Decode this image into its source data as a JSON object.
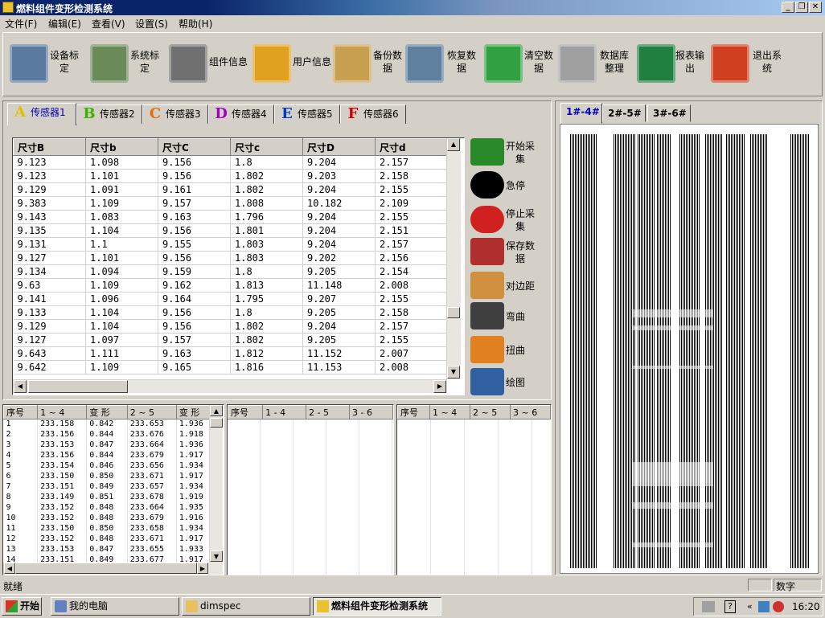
{
  "window": {
    "title": "燃料组件变形检测系统"
  },
  "menu": [
    "文件(F)",
    "编辑(E)",
    "查看(V)",
    "设置(S)",
    "帮助(H)"
  ],
  "toolbar": [
    {
      "label": "设备标\n定",
      "icon": "device-calibration-icon",
      "color": "#5a7aa0"
    },
    {
      "label": "系统标\n定",
      "icon": "system-calibration-icon",
      "color": "#6a8a5a"
    },
    {
      "label": "组件信息",
      "icon": "gears-icon",
      "color": "#707070"
    },
    {
      "label": "用户信息",
      "icon": "users-icon",
      "color": "#e0a020"
    },
    {
      "label": "备份数\n据",
      "icon": "backup-icon",
      "color": "#c8a050"
    },
    {
      "label": "恢复数\n据",
      "icon": "restore-icon",
      "color": "#6080a0"
    },
    {
      "label": "清空数\n据",
      "icon": "recycle-bin-icon",
      "color": "#30a040"
    },
    {
      "label": "数据库\n整理",
      "icon": "wrench-icon",
      "color": "#a0a0a0"
    },
    {
      "label": "报表输\n出",
      "icon": "excel-icon",
      "color": "#208040"
    },
    {
      "label": "退出系\n统",
      "icon": "windows-logo-icon",
      "color": "#d04020"
    }
  ],
  "sensor_tabs": [
    {
      "letter": "A",
      "label": "传感器1",
      "color": "#e0c000"
    },
    {
      "letter": "B",
      "label": "传感器2",
      "color": "#40b000"
    },
    {
      "letter": "C",
      "label": "传感器3",
      "color": "#e07000"
    },
    {
      "letter": "D",
      "label": "传感器4",
      "color": "#a000c0"
    },
    {
      "letter": "E",
      "label": "传感器5",
      "color": "#0040c0"
    },
    {
      "letter": "F",
      "label": "传感器6",
      "color": "#d00000"
    }
  ],
  "main_grid": {
    "headers": [
      "尺寸B",
      "尺寸b",
      "尺寸C",
      "尺寸c",
      "尺寸D",
      "尺寸d"
    ],
    "rows": [
      [
        "9.123",
        "1.098",
        "9.156",
        "1.8",
        "9.204",
        "2.157"
      ],
      [
        "9.123",
        "1.101",
        "9.156",
        "1.802",
        "9.203",
        "2.158"
      ],
      [
        "9.129",
        "1.091",
        "9.161",
        "1.802",
        "9.204",
        "2.155"
      ],
      [
        "9.383",
        "1.109",
        "9.157",
        "1.808",
        "10.182",
        "2.109"
      ],
      [
        "9.143",
        "1.083",
        "9.163",
        "1.796",
        "9.204",
        "2.155"
      ],
      [
        "9.135",
        "1.104",
        "9.156",
        "1.801",
        "9.204",
        "2.151"
      ],
      [
        "9.131",
        "1.1",
        "9.155",
        "1.803",
        "9.204",
        "2.157"
      ],
      [
        "9.127",
        "1.101",
        "9.156",
        "1.803",
        "9.202",
        "2.156"
      ],
      [
        "9.134",
        "1.094",
        "9.159",
        "1.8",
        "9.205",
        "2.154"
      ],
      [
        "9.63",
        "1.109",
        "9.162",
        "1.813",
        "11.148",
        "2.008"
      ],
      [
        "9.141",
        "1.096",
        "9.164",
        "1.795",
        "9.207",
        "2.155"
      ],
      [
        "9.133",
        "1.104",
        "9.156",
        "1.8",
        "9.205",
        "2.158"
      ],
      [
        "9.129",
        "1.104",
        "9.156",
        "1.802",
        "9.204",
        "2.157"
      ],
      [
        "9.127",
        "1.097",
        "9.157",
        "1.802",
        "9.205",
        "2.155"
      ],
      [
        "9.643",
        "1.111",
        "9.163",
        "1.812",
        "11.152",
        "2.007"
      ],
      [
        "9.642",
        "1.109",
        "9.165",
        "1.816",
        "11.153",
        "2.008"
      ]
    ]
  },
  "side_buttons": [
    {
      "label": "开始采\n集",
      "icon": "start-collect-icon",
      "color": "#2a8a2a"
    },
    {
      "label": "急停",
      "icon": "emergency-stop-icon",
      "color": "#000000"
    },
    {
      "label": "停止采\n集",
      "icon": "stop-hand-icon",
      "color": "#d02020"
    },
    {
      "label": "保存数\n据",
      "icon": "save-icon",
      "color": "#b03030"
    },
    {
      "label": "对边距",
      "icon": "ruler-icon",
      "color": "#d09040"
    },
    {
      "label": "弯曲",
      "icon": "bend-icon",
      "color": "#404040"
    },
    {
      "label": "扭曲",
      "icon": "twist-icon",
      "color": "#e08020"
    },
    {
      "label": "绘图",
      "icon": "draw-icon",
      "color": "#3060a0"
    }
  ],
  "deform_table": {
    "headers": [
      "序号",
      "1 ~ 4",
      "变 形",
      "2 ~ 5",
      "变 形"
    ],
    "rows": [
      [
        "1",
        "233.158",
        "0.842",
        "233.653",
        "1.936"
      ],
      [
        "2",
        "233.156",
        "0.844",
        "233.676",
        "1.918"
      ],
      [
        "3",
        "233.153",
        "0.847",
        "233.664",
        "1.936"
      ],
      [
        "4",
        "233.156",
        "0.844",
        "233.679",
        "1.917"
      ],
      [
        "5",
        "233.154",
        "0.846",
        "233.656",
        "1.934"
      ],
      [
        "6",
        "233.150",
        "0.850",
        "233.671",
        "1.917"
      ],
      [
        "7",
        "233.151",
        "0.849",
        "233.657",
        "1.934"
      ],
      [
        "8",
        "233.149",
        "0.851",
        "233.678",
        "1.919"
      ],
      [
        "9",
        "233.152",
        "0.848",
        "233.664",
        "1.935"
      ],
      [
        "10",
        "233.152",
        "0.848",
        "233.679",
        "1.916"
      ],
      [
        "11",
        "233.150",
        "0.850",
        "233.658",
        "1.934"
      ],
      [
        "12",
        "233.152",
        "0.848",
        "233.671",
        "1.917"
      ],
      [
        "13",
        "233.153",
        "0.847",
        "233.655",
        "1.933"
      ],
      [
        "14",
        "233.151",
        "0.849",
        "233.677",
        "1.917"
      ]
    ]
  },
  "mid_table": {
    "headers": [
      "序号",
      "1 - 4",
      "2 - 5",
      "3 - 6"
    ]
  },
  "right_table": {
    "headers": [
      "序号",
      "1 ~ 4",
      "2 ~ 5",
      "3 ~ 6"
    ]
  },
  "plot_tabs": [
    "1#-4#",
    "2#-5#",
    "3#-6#"
  ],
  "status": {
    "text": "就绪",
    "mode": "数字"
  },
  "taskbar": {
    "start": "开始",
    "items": [
      "我的电脑",
      "dimspec",
      "燃料组件变形检测系统"
    ],
    "time": "16:20"
  }
}
